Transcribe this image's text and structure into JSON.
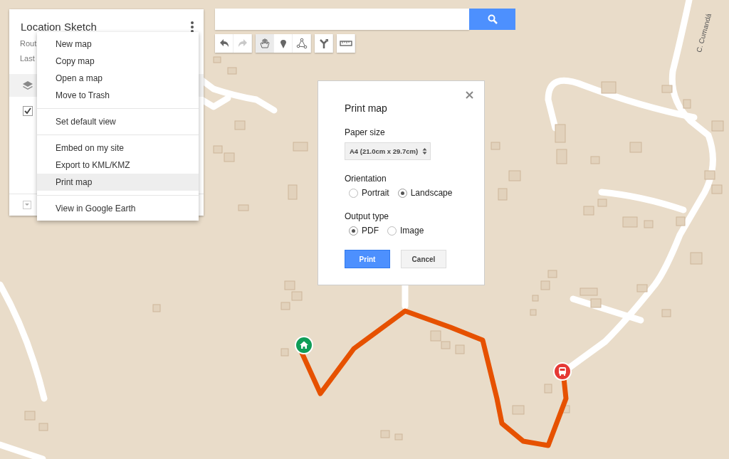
{
  "map": {
    "street_label": "C. Cumandá"
  },
  "panel": {
    "title": "Location Sketch",
    "subtitle": "Rout",
    "last_edited": "Last",
    "layer": {
      "checked": true
    }
  },
  "menu": {
    "groups": [
      [
        {
          "label": "New map",
          "selected": false
        },
        {
          "label": "Copy map",
          "selected": false
        },
        {
          "label": "Open a map",
          "selected": false
        },
        {
          "label": "Move to Trash",
          "selected": false
        }
      ],
      [
        {
          "label": "Set default view",
          "selected": false
        }
      ],
      [
        {
          "label": "Embed on my site",
          "selected": false
        },
        {
          "label": "Export to KML/KMZ",
          "selected": false
        },
        {
          "label": "Print map",
          "selected": true
        }
      ],
      [
        {
          "label": "View in Google Earth",
          "selected": false
        }
      ]
    ]
  },
  "toolbar": [
    [
      {
        "kind": "undo",
        "selected": false,
        "disabled": false
      },
      {
        "kind": "redo",
        "selected": false,
        "disabled": true
      }
    ],
    [
      {
        "kind": "hand",
        "selected": true,
        "disabled": false
      },
      {
        "kind": "marker",
        "selected": false,
        "disabled": false
      },
      {
        "kind": "line",
        "selected": false,
        "disabled": false
      }
    ],
    [
      {
        "kind": "directions",
        "selected": false,
        "disabled": false
      }
    ],
    [
      {
        "kind": "ruler",
        "selected": false,
        "disabled": false
      }
    ]
  ],
  "dialog": {
    "title": "Print map",
    "paper_size": {
      "label": "Paper size",
      "value": "A4 (21.0cm x 29.7cm)"
    },
    "orientation": {
      "label": "Orientation",
      "options": [
        {
          "label": "Portrait",
          "selected": false
        },
        {
          "label": "Landscape",
          "selected": true
        }
      ]
    },
    "output_type": {
      "label": "Output type",
      "options": [
        {
          "label": "PDF",
          "selected": true
        },
        {
          "label": "Image",
          "selected": false
        }
      ]
    },
    "buttons": [
      {
        "kind": "primary",
        "label": "Print"
      },
      {
        "kind": "secondary",
        "label": "Cancel"
      }
    ]
  }
}
